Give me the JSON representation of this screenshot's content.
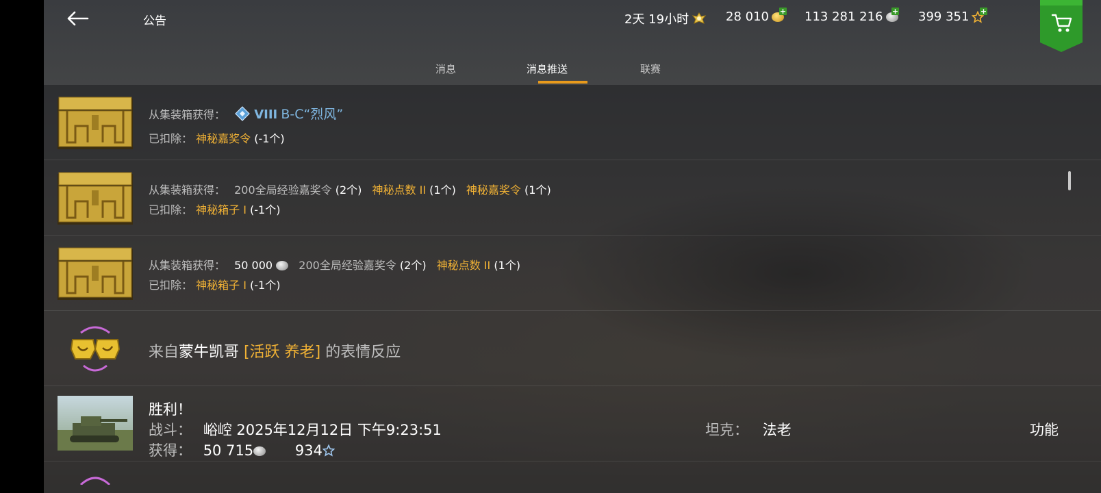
{
  "header": {
    "title": "公告",
    "timer": "2天 19小时",
    "gold": "28 010",
    "credits": "113 281 216",
    "free_xp": "399 351"
  },
  "tabs": [
    {
      "label": "消息"
    },
    {
      "label": "消息推送"
    },
    {
      "label": "联赛"
    }
  ],
  "active_tab": "消息推送",
  "notifications": [
    {
      "source_label": "从集装箱获得：",
      "tier": "VIII",
      "tank": "B-C“烈风”",
      "deducted_label": "已扣除：",
      "deducted_item": "神秘嘉奖令",
      "deducted_count": "(-1个)"
    },
    {
      "source_label": "从集装箱获得：",
      "item1": "200全局经验嘉奖令",
      "count1": "(2个)",
      "item2": "神秘点数 II",
      "count2": "(1个)",
      "item3": "神秘嘉奖令",
      "count3": "(1个)",
      "deducted_label": "已扣除：",
      "deducted_item": "神秘箱子 I",
      "deducted_count": "(-1个)"
    },
    {
      "source_label": "从集装箱获得：",
      "credits": "50 000",
      "item1": "200全局经验嘉奖令",
      "count1": "(2个)",
      "item2": "神秘点数 II",
      "count2": "(1个)",
      "deducted_label": "已扣除：",
      "deducted_item": "神秘箱子 I",
      "deducted_count": "(-1个)"
    },
    {
      "prefix": "来自",
      "user": "蒙牛凯哥",
      "clan": "[活跃 养老]",
      "suffix": "的表情反应"
    },
    {
      "result": "胜利！",
      "battle_label": "战斗：",
      "battle_value": "峪崆 2025年12月12日 下午9:23:51",
      "tank_label": "坦克：",
      "tank_value": "法老",
      "earned_label": "获得：",
      "earned_credits": "50 715",
      "earned_xp": "934",
      "action": "功能"
    }
  ],
  "colors": {
    "accent_orange": "#e89a1c",
    "item_gold": "#f1b235",
    "premium_green": "#2e9a2a"
  }
}
